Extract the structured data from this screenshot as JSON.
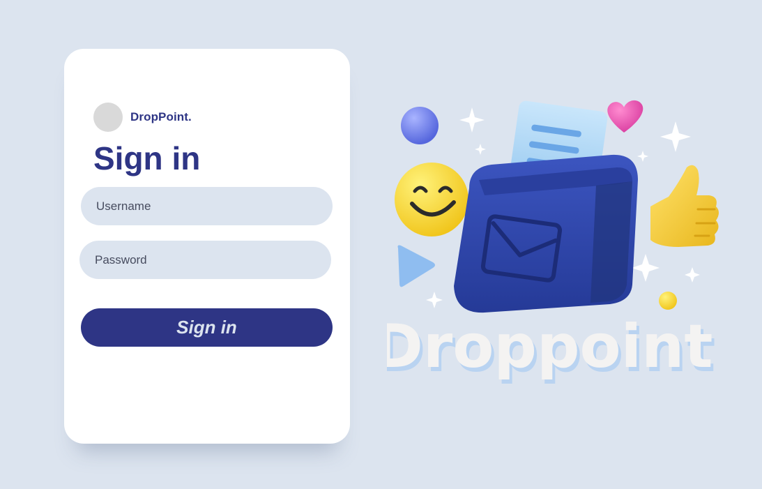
{
  "brand": {
    "name": "DropPoint."
  },
  "form": {
    "title": "Sign in",
    "username_placeholder": "Username",
    "password_placeholder": "Password",
    "submit_label": "Sign in"
  },
  "illustration": {
    "wordmark": "Droppoint",
    "icons": [
      "mailbox-icon",
      "smiley-icon",
      "heart-icon",
      "thumbs-up-icon",
      "sparkle-icon",
      "play-triangle-icon",
      "sphere-icon"
    ]
  },
  "colors": {
    "background": "#dce4ef",
    "primary": "#2e3585",
    "card": "#ffffff",
    "input_fill": "#dce4ef"
  }
}
